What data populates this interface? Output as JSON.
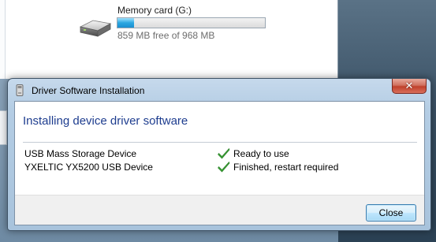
{
  "explorer": {
    "drive": {
      "name": "Memory card (G:)",
      "free_text": "859 MB free of 968 MB",
      "used_fraction": 0.113,
      "icon": "removable-drive-icon"
    }
  },
  "dialog": {
    "title": "Driver Software Installation",
    "title_icon": "usb-device-icon",
    "close_glyph": "✕",
    "heading": "Installing device driver software",
    "devices": [
      {
        "name": "USB Mass Storage Device",
        "status": "Ready to use",
        "status_icon": "green-check-icon"
      },
      {
        "name": "YXELTIC YX5200 USB Device",
        "status": "Finished, restart required",
        "status_icon": "green-check-icon"
      }
    ],
    "close_button_label": "Close"
  },
  "colors": {
    "heading": "#1e3d8f",
    "progress_fill": "#2aa6e0",
    "check": "#3aa335",
    "title_close": "#c0402b"
  }
}
